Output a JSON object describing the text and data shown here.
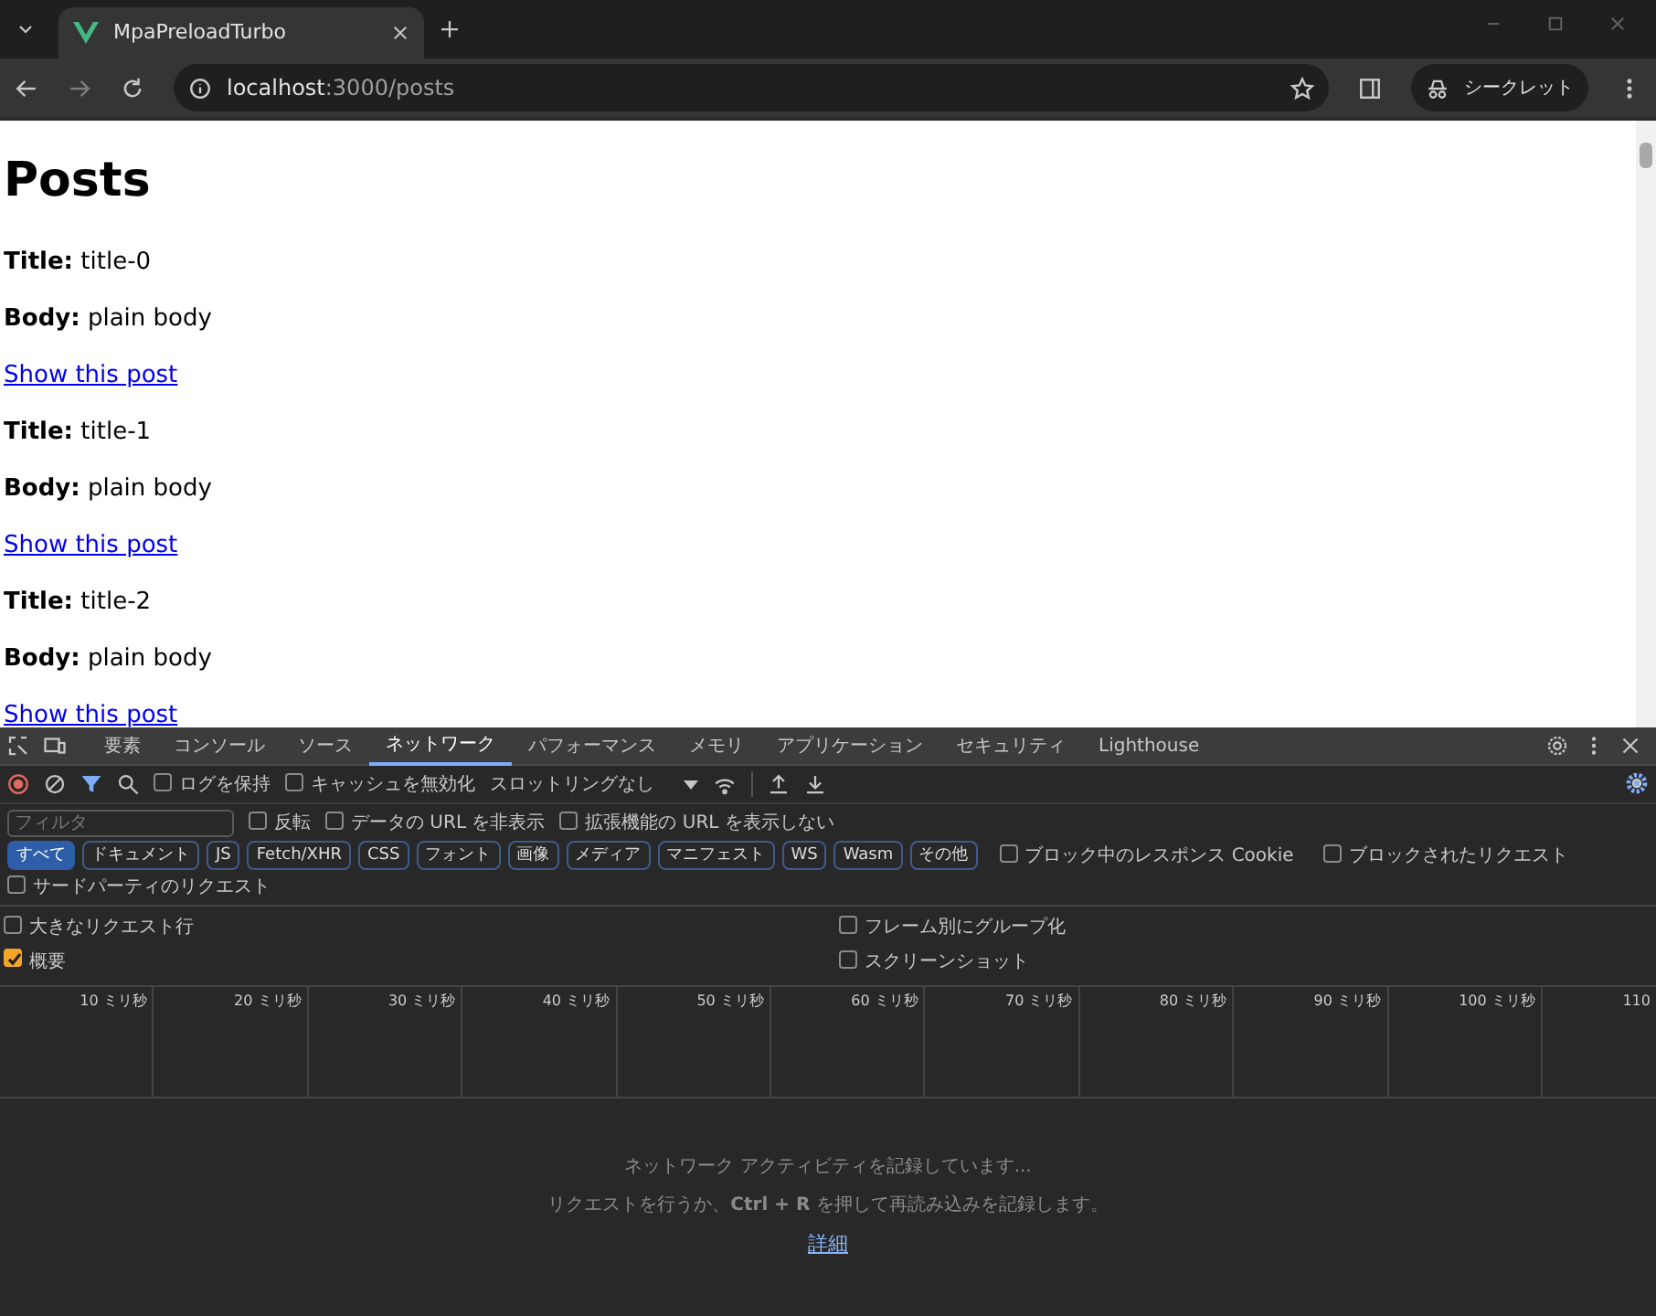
{
  "browser": {
    "tab_title": "MpaPreloadTurbo",
    "url_host": "localhost",
    "url_path": ":3000/posts",
    "profile": "シークレット"
  },
  "page": {
    "heading": "Posts",
    "posts": [
      {
        "title_label": "Title:",
        "title": "title-0",
        "body_label": "Body:",
        "body": "plain body",
        "link": "Show this post"
      },
      {
        "title_label": "Title:",
        "title": "title-1",
        "body_label": "Body:",
        "body": "plain body",
        "link": "Show this post"
      },
      {
        "title_label": "Title:",
        "title": "title-2",
        "body_label": "Body:",
        "body": "plain body",
        "link": "Show this post"
      }
    ]
  },
  "devtools": {
    "panel_tabs": [
      {
        "label": "要素",
        "selected": false
      },
      {
        "label": "コンソール",
        "selected": false
      },
      {
        "label": "ソース",
        "selected": false
      },
      {
        "label": "ネットワーク",
        "selected": true
      },
      {
        "label": "パフォーマンス",
        "selected": false
      },
      {
        "label": "メモリ",
        "selected": false
      },
      {
        "label": "アプリケーション",
        "selected": false
      },
      {
        "label": "セキュリティ",
        "selected": false
      },
      {
        "label": "Lighthouse",
        "selected": false
      }
    ],
    "toolbar_checks": [
      {
        "label": "ログを保持",
        "checked": false
      },
      {
        "label": "キャッシュを無効化",
        "checked": false
      }
    ],
    "throttling": "スロットリングなし",
    "filter_placeholder": "フィルタ",
    "filter_checks": [
      {
        "label": "反転",
        "checked": false
      },
      {
        "label": "データの URL を非表示",
        "checked": false
      },
      {
        "label": "拡張機能の URL を表示しない",
        "checked": false
      }
    ],
    "type_chips": [
      {
        "label": "すべて",
        "selected": true
      },
      {
        "label": "ドキュメント",
        "selected": false
      },
      {
        "label": "JS",
        "selected": false
      },
      {
        "label": "Fetch/XHR",
        "selected": false
      },
      {
        "label": "CSS",
        "selected": false
      },
      {
        "label": "フォント",
        "selected": false
      },
      {
        "label": "画像",
        "selected": false
      },
      {
        "label": "メディア",
        "selected": false
      },
      {
        "label": "マニフェスト",
        "selected": false
      },
      {
        "label": "WS",
        "selected": false
      },
      {
        "label": "Wasm",
        "selected": false
      },
      {
        "label": "その他",
        "selected": false
      }
    ],
    "chip_checks": [
      {
        "label": "ブロック中のレスポンス Cookie",
        "checked": false
      },
      {
        "label": "ブロックされたリクエスト",
        "checked": false
      },
      {
        "label": "サードパーティのリクエスト",
        "checked": false
      }
    ],
    "settings": [
      {
        "label": "大きなリクエスト行",
        "checked": false
      },
      {
        "label": "フレーム別にグループ化",
        "checked": false
      },
      {
        "label": "概要",
        "checked": true
      },
      {
        "label": "スクリーンショット",
        "checked": false
      }
    ],
    "timeline_ticks": [
      "10 ミリ秒",
      "20 ミリ秒",
      "30 ミリ秒",
      "40 ミリ秒",
      "50 ミリ秒",
      "60 ミリ秒",
      "70 ミリ秒",
      "80 ミリ秒",
      "90 ミリ秒",
      "100 ミリ秒",
      "110"
    ],
    "empty_message": "ネットワーク アクティビティを記録しています...",
    "empty_hint": "リクエストを行うか、**Ctrl + R** を押して再読み込みを記録します。",
    "empty_link": "詳細"
  }
}
